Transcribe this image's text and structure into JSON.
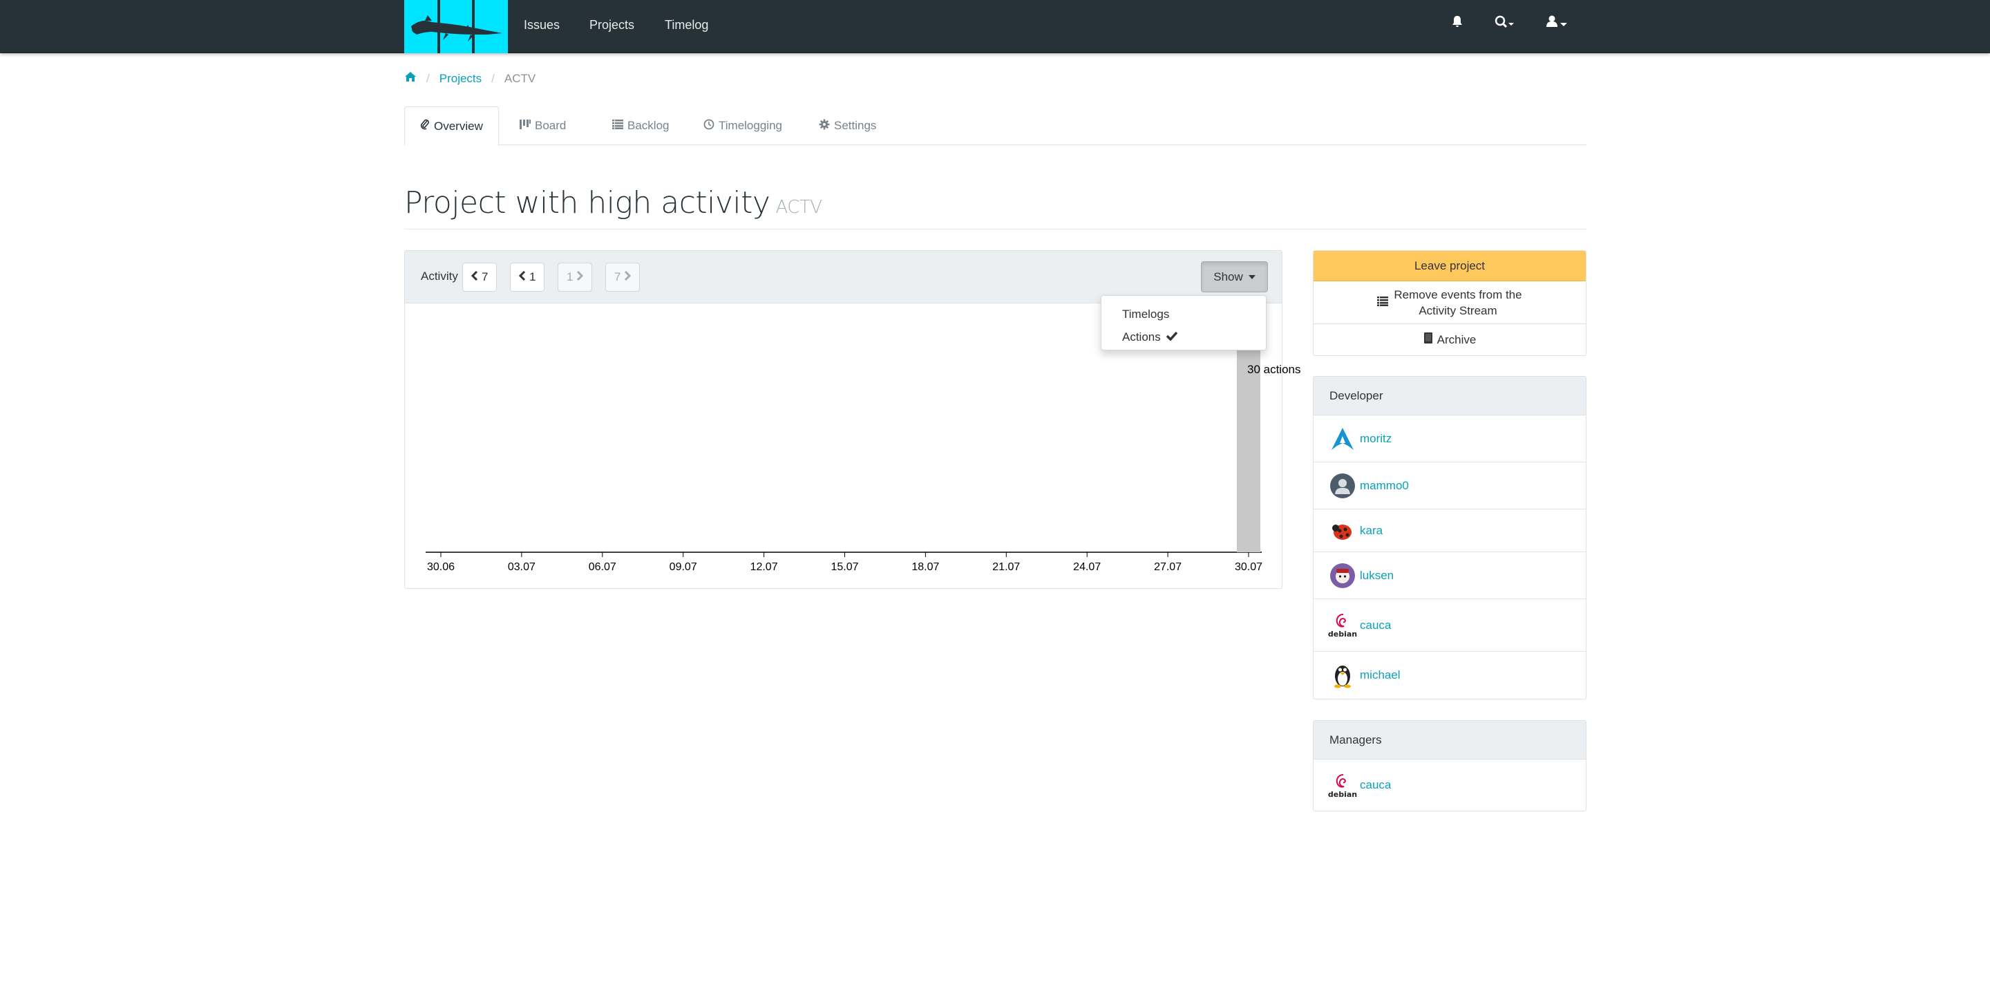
{
  "nav": {
    "links": [
      "Issues",
      "Projects",
      "Timelog"
    ],
    "icons": [
      "bell-icon",
      "search-icon",
      "user-icon"
    ]
  },
  "breadcrumb": {
    "items": [
      "Projects",
      "ACTV"
    ]
  },
  "tabs": [
    "Overview",
    "Board",
    "Backlog",
    "Timelogging",
    "Settings"
  ],
  "title": {
    "main": "Project with high activity",
    "key": "ACTV"
  },
  "activity": {
    "label": "Activity",
    "buttons": [
      "7",
      "1",
      "1",
      "7"
    ],
    "show_label": "Show",
    "dropdown": [
      "Timelogs",
      "Actions"
    ]
  },
  "chart_data": {
    "type": "bar",
    "x_ticks": [
      "30.06",
      "03.07",
      "06.07",
      "09.07",
      "12.07",
      "15.07",
      "18.07",
      "21.07",
      "24.07",
      "27.07",
      "30.07"
    ],
    "series": [
      {
        "name": "actions",
        "points": [
          {
            "x": "30.07",
            "y": 30
          }
        ]
      }
    ],
    "bar_label": "30 actions",
    "colors": {
      "bar": "#c8c8c8",
      "axis": "#000000"
    }
  },
  "actions": {
    "leave": "Leave project",
    "remove_line1": "Remove events from the",
    "remove_line2": "Activity Stream",
    "archive": "Archive"
  },
  "developers": {
    "heading": "Developer",
    "members": [
      "moritz",
      "mammo0",
      "kara",
      "luksen",
      "cauca",
      "michael"
    ]
  },
  "managers": {
    "heading": "Managers",
    "members": [
      "cauca"
    ]
  },
  "avatar_text": {
    "debian": "debian"
  },
  "colors": {
    "navbar": "#263238",
    "logo": "#00e5ff",
    "link": "#0aa1b8",
    "warning": "#ffc85c"
  }
}
